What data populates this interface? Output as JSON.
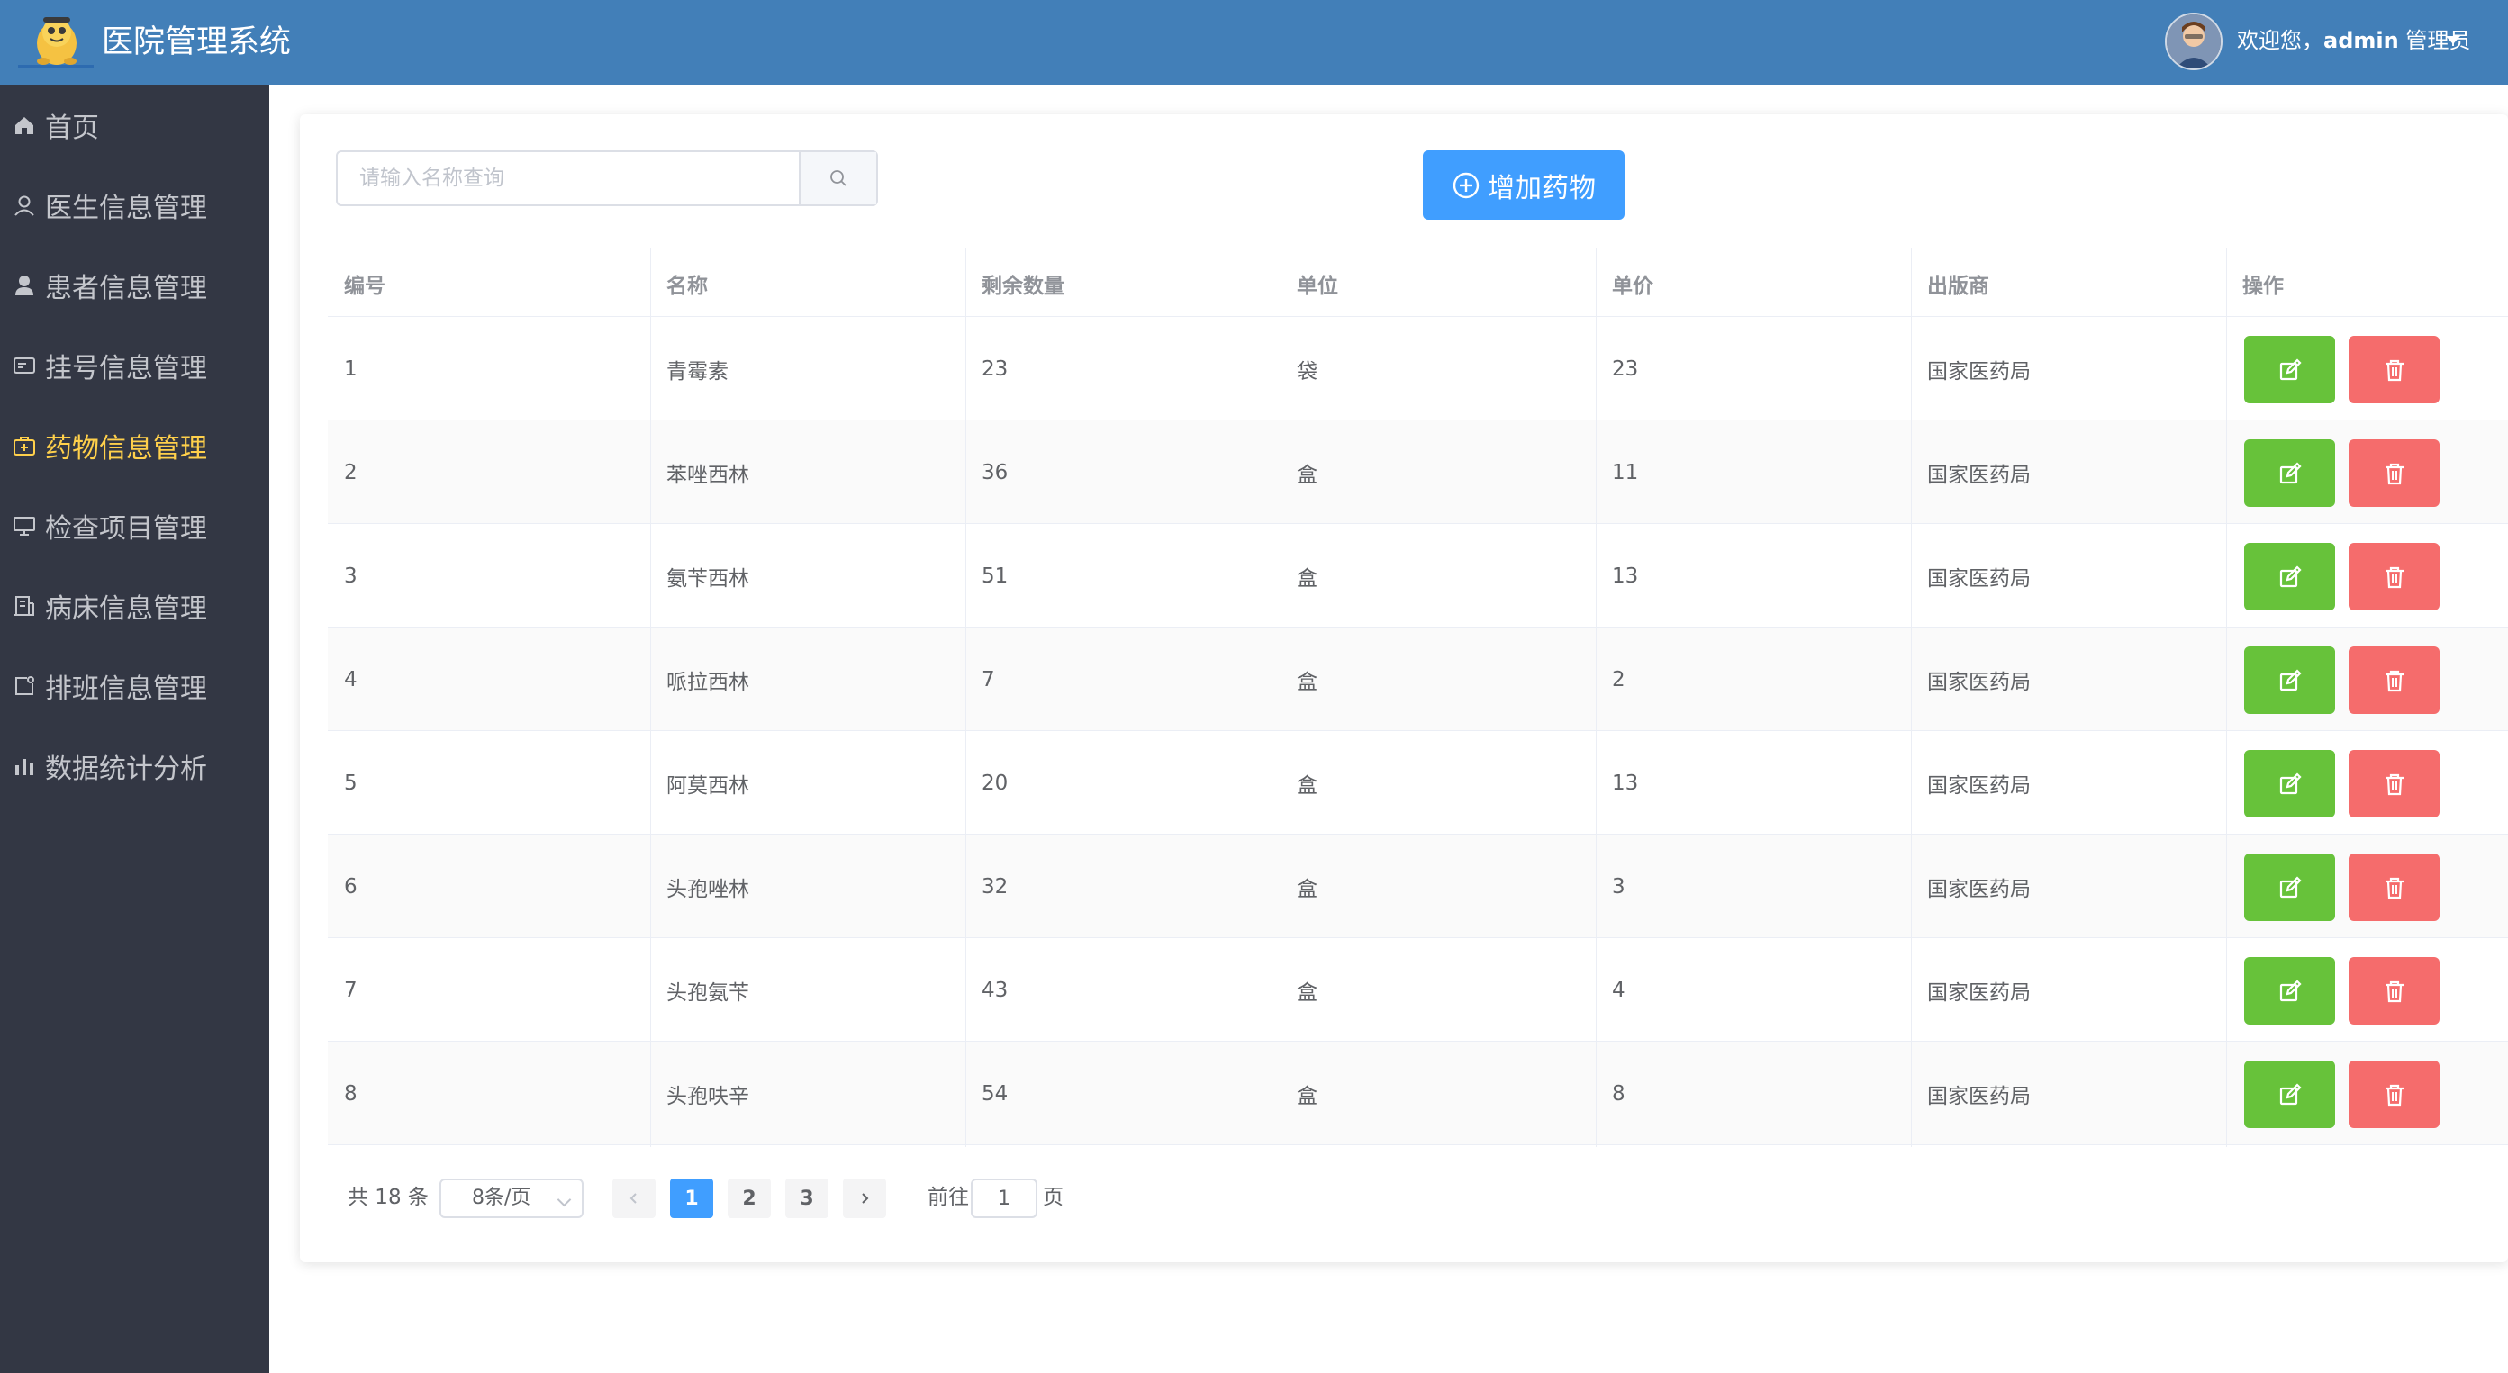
{
  "header": {
    "title": "医院管理系统",
    "welcome_prefix": "欢迎您，",
    "username": "admin",
    "role": " 管理员"
  },
  "sidebar": {
    "items": [
      {
        "label": "首页",
        "icon": "home-icon",
        "active": false
      },
      {
        "label": "医生信息管理",
        "icon": "user-icon",
        "active": false
      },
      {
        "label": "患者信息管理",
        "icon": "user-solid-icon",
        "active": false
      },
      {
        "label": "挂号信息管理",
        "icon": "postcard-icon",
        "active": false
      },
      {
        "label": "药物信息管理",
        "icon": "first-aid-kit-icon",
        "active": true
      },
      {
        "label": "检查项目管理",
        "icon": "monitor-icon",
        "active": false
      },
      {
        "label": "病床信息管理",
        "icon": "office-building-icon",
        "active": false
      },
      {
        "label": "排班信息管理",
        "icon": "schedule-icon",
        "active": false
      },
      {
        "label": "数据统计分析",
        "icon": "bar-chart-icon",
        "active": false
      }
    ]
  },
  "toolbar": {
    "search_placeholder": "请输入名称查询",
    "add_label": "增加药物"
  },
  "table": {
    "headers": [
      "编号",
      "名称",
      "剩余数量",
      "单位",
      "单价",
      "出版商",
      "操作"
    ],
    "rows": [
      [
        "1",
        "青霉素",
        "23",
        "袋",
        "23",
        "国家医药局"
      ],
      [
        "2",
        "苯唑西林",
        "36",
        "盒",
        "11",
        "国家医药局"
      ],
      [
        "3",
        "氨苄西林",
        "51",
        "盒",
        "13",
        "国家医药局"
      ],
      [
        "4",
        "哌拉西林",
        "7",
        "盒",
        "2",
        "国家医药局"
      ],
      [
        "5",
        "阿莫西林",
        "20",
        "盒",
        "13",
        "国家医药局"
      ],
      [
        "6",
        "头孢唑林",
        "32",
        "盒",
        "3",
        "国家医药局"
      ],
      [
        "7",
        "头孢氨苄",
        "43",
        "盒",
        "4",
        "国家医药局"
      ],
      [
        "8",
        "头孢呋辛",
        "54",
        "盒",
        "8",
        "国家医药局"
      ]
    ]
  },
  "pagination": {
    "total_text": "共 18 条",
    "page_size": "8条/页",
    "pages": [
      "1",
      "2",
      "3"
    ],
    "current_page": "1",
    "goto_label": "前往",
    "goto_value": "1",
    "page_unit": "页"
  },
  "colors": {
    "header_bg": "#427fb8",
    "sidebar_bg": "#333744",
    "active_menu": "#ffd04b",
    "primary": "#409eff",
    "success": "#67c23a",
    "danger": "#f56c6c"
  }
}
